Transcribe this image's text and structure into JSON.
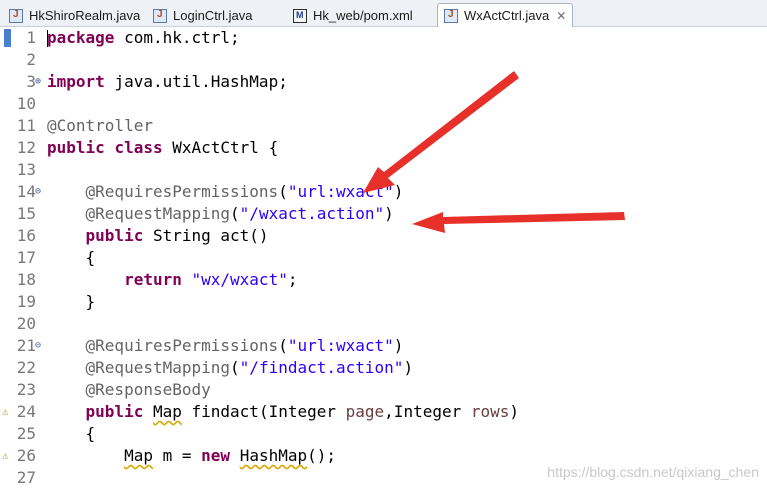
{
  "tabs": [
    {
      "label": "HkShiroRealm.java",
      "icon": "java-file-icon",
      "active": false
    },
    {
      "label": "LoginCtrl.java",
      "icon": "java-file-icon",
      "active": false
    },
    {
      "label": "Hk_web/pom.xml",
      "icon": "maven-xml-icon",
      "active": false
    },
    {
      "label": "WxActCtrl.java",
      "icon": "java-file-icon",
      "active": true,
      "close": "✕"
    }
  ],
  "lines": [
    {
      "num": "1",
      "tokens": [
        [
          "kw",
          "package"
        ],
        [
          "",
          "com.hk.ctrl;"
        ]
      ]
    },
    {
      "num": "2",
      "tokens": [
        [
          "",
          ""
        ]
      ]
    },
    {
      "num": "3",
      "tokens": [
        [
          "kw",
          "import"
        ],
        [
          "",
          "java.util.HashMap;"
        ]
      ]
    },
    {
      "num": "10",
      "tokens": [
        [
          "",
          ""
        ]
      ]
    },
    {
      "num": "11",
      "tokens": [
        [
          "ann",
          "@Controller"
        ]
      ]
    },
    {
      "num": "12",
      "tokens": [
        [
          "kw",
          "public"
        ],
        [
          "",
          " "
        ],
        [
          "kw",
          "class"
        ],
        [
          "",
          " WxActCtrl {"
        ]
      ]
    },
    {
      "num": "13",
      "tokens": [
        [
          "",
          ""
        ]
      ]
    },
    {
      "num": "14",
      "tokens": [
        [
          "",
          "    "
        ],
        [
          "ann",
          "@RequiresPermissions"
        ],
        [
          "",
          "("
        ],
        [
          "str",
          "\"url:wxact\""
        ],
        [
          "",
          ")"
        ]
      ]
    },
    {
      "num": "15",
      "tokens": [
        [
          "",
          "    "
        ],
        [
          "ann",
          "@RequestMapping"
        ],
        [
          "",
          "("
        ],
        [
          "str",
          "\"/wxact.action\""
        ],
        [
          "",
          ")"
        ]
      ]
    },
    {
      "num": "16",
      "tokens": [
        [
          "",
          "    "
        ],
        [
          "kw",
          "public"
        ],
        [
          "",
          " String act()"
        ]
      ]
    },
    {
      "num": "17",
      "tokens": [
        [
          "",
          "    {"
        ]
      ]
    },
    {
      "num": "18",
      "tokens": [
        [
          "",
          "        "
        ],
        [
          "kw",
          "return"
        ],
        [
          "",
          " "
        ],
        [
          "str",
          "\"wx/wxact\""
        ],
        [
          "",
          ";"
        ]
      ]
    },
    {
      "num": "19",
      "tokens": [
        [
          "",
          "    }"
        ]
      ]
    },
    {
      "num": "20",
      "tokens": [
        [
          "",
          ""
        ]
      ]
    },
    {
      "num": "21",
      "tokens": [
        [
          "",
          "    "
        ],
        [
          "ann",
          "@RequiresPermissions"
        ],
        [
          "",
          "("
        ],
        [
          "str",
          "\"url:wxact\""
        ],
        [
          "",
          ")"
        ]
      ]
    },
    {
      "num": "22",
      "tokens": [
        [
          "",
          "    "
        ],
        [
          "ann",
          "@RequestMapping"
        ],
        [
          "",
          "("
        ],
        [
          "str",
          "\"/findact.action\""
        ],
        [
          "",
          ")"
        ]
      ]
    },
    {
      "num": "23",
      "tokens": [
        [
          "",
          "    "
        ],
        [
          "ann",
          "@ResponseBody"
        ]
      ]
    },
    {
      "num": "24",
      "tokens": [
        [
          "",
          "    "
        ],
        [
          "kw",
          "public"
        ],
        [
          "",
          " "
        ],
        [
          "warn",
          "Map"
        ],
        [
          "",
          " findact(Integer "
        ],
        [
          "fld",
          "page"
        ],
        [
          "",
          ",Integer "
        ],
        [
          "fld",
          "rows"
        ],
        [
          "",
          ")"
        ]
      ]
    },
    {
      "num": "25",
      "tokens": [
        [
          "",
          "    {"
        ]
      ]
    },
    {
      "num": "26",
      "tokens": [
        [
          "",
          "        "
        ],
        [
          "warn",
          "Map"
        ],
        [
          "",
          " m = "
        ],
        [
          "kw",
          "new"
        ],
        [
          "",
          " "
        ],
        [
          "warn",
          "HashMap"
        ],
        [
          "",
          "();"
        ]
      ]
    },
    {
      "num": "27",
      "tokens": [
        [
          "",
          ""
        ]
      ]
    }
  ],
  "fold_marker": "⊖",
  "fold_expand_marker": "⊕",
  "warning_marker": "⚠",
  "watermark": "https://blog.csdn.net/qixiang_chen",
  "colors": {
    "keyword": "#7f0055",
    "annotation": "#646464",
    "string": "#2a00ff",
    "field": "#6a3e3e",
    "arrow": "#e8302a",
    "line_number": "#787878"
  }
}
